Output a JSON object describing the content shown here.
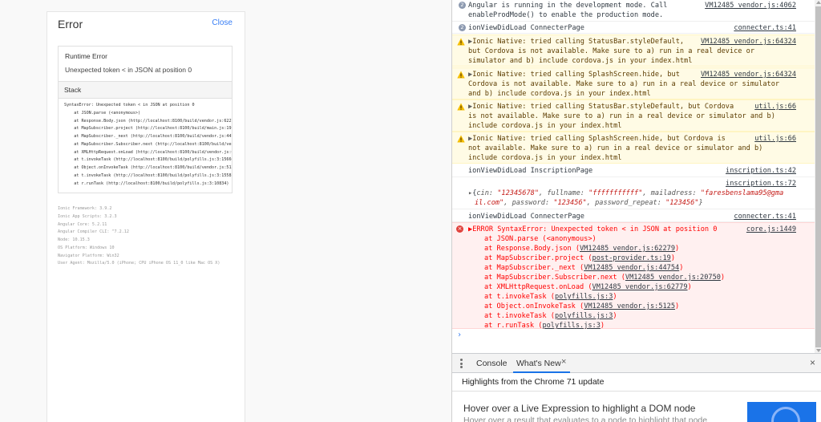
{
  "modal": {
    "title": "Error",
    "close_label": "Close",
    "runtime_title": "Runtime Error",
    "runtime_message": "Unexpected token < in JSON at position 0",
    "stack_title": "Stack",
    "stack_lines": [
      "SyntaxError: Unexpected token < in JSON at position 0",
      "    at JSON.parse (<anonymous>)",
      "    at Response.Body.json (http://localhost:8100/build/vendor.js:62279:25)",
      "    at MapSubscriber.project (http://localhost:8100/build/main.js:19:21)",
      "    at MapSubscriber._next (http://localhost:8100/build/vendor.js:44754:35)",
      "    at MapSubscriber.Subscriber.next (http://localhost:8100/build/vendor.js:20750:18)",
      "    at XMLHttpRequest.onLoad (http://localhost:8100/build/vendor.js:62779:51)",
      "    at t.invokeTask (http://localhost:8100/build/polyfills.js:3:15660)",
      "    at Object.onInvokeTask (http://localhost:8100/build/vendor.js:5125:33)",
      "    at t.invokeTask (http://localhost:8100/build/polyfills.js:3:15581)",
      "    at r.runTask (http://localhost:8100/build/polyfills.js:3:10834)"
    ],
    "env_lines": [
      "Ionic Framework: 3.9.2",
      "Ionic App Scripts: 3.2.3",
      "Angular Core: 5.2.11",
      "Angular Compiler CLI: ^7.2.12",
      "Node: 10.15.3",
      "OS Platform: Windows 10",
      "Navigator Platform: Win32",
      "User Agent: Mozilla/5.0 (iPhone; CPU iPhone OS 11_0 like Mac OS X)"
    ]
  },
  "console": {
    "messages": [
      {
        "kind": "info",
        "count": "2",
        "lines": [
          "Angular is running in the development mode. Call",
          "enableProdMode() to enable the production mode."
        ],
        "source": "VM12485 vendor.js:4062"
      },
      {
        "kind": "info",
        "count": "2",
        "lines": [
          "ionViewDidLoad ConnecterPage"
        ],
        "source": "connecter.ts:41"
      },
      {
        "kind": "warn",
        "lines": [
          "Ionic Native: tried calling StatusBar.styleDefault,",
          "but Cordova is not available. Make sure to a) run in a real device or",
          "simulator and b) include cordova.js in your index.html"
        ],
        "source": "VM12485 vendor.js:64324"
      },
      {
        "kind": "warn",
        "lines": [
          "Ionic Native: tried calling SplashScreen.hide, but",
          "Cordova is not available. Make sure to a) run in a real device or simulator",
          "and b) include cordova.js in your index.html"
        ],
        "source": "VM12485 vendor.js:64324"
      },
      {
        "kind": "warn",
        "lines": [
          "Ionic Native: tried calling StatusBar.styleDefault, but Cordova",
          "is not available. Make sure to a) run in a real device or simulator and b)",
          "include cordova.js in your index.html"
        ],
        "source": "util.js:66"
      },
      {
        "kind": "warn",
        "lines": [
          "Ionic Native: tried calling SplashScreen.hide, but Cordova is",
          "not available. Make sure to a) run in a real device or simulator and b)",
          "include cordova.js in your index.html"
        ],
        "source": "util.js:66"
      },
      {
        "kind": "log",
        "lines": [
          "ionViewDidLoad InscriptionPage"
        ],
        "source": "inscription.ts:42"
      },
      {
        "kind": "log",
        "lines": [],
        "source": "inscription.ts:72"
      },
      {
        "kind": "log",
        "lines": [
          "ionViewDidLoad ConnecterPage"
        ],
        "source": "connecter.ts:41"
      }
    ],
    "object_log": {
      "line1_keys": [
        "cin: ",
        "fullname: ",
        "mailadress: "
      ],
      "line1_vals": [
        "\"12345678\"",
        "\"fffffffffff\"",
        "\"faresbenslama95@gma"
      ],
      "line2_pre": "il.com\"",
      "line2_keys": [
        "password: ",
        "password_repeat: "
      ],
      "line2_vals": [
        "\"123456\"",
        "\"123456\""
      ]
    },
    "error": {
      "header": "ERROR SyntaxError: Unexpected token < in JSON at position 0",
      "source": "core.js:1449",
      "frames": [
        {
          "text": "at JSON.parse (<anonymous>)",
          "link": ""
        },
        {
          "text": "at Response.Body.json (",
          "link": "VM12485 vendor.js:62279"
        },
        {
          "text": "at MapSubscriber.project (",
          "link": "post-provider.ts:19"
        },
        {
          "text": "at MapSubscriber._next (",
          "link": "VM12485 vendor.js:44754"
        },
        {
          "text": "at MapSubscriber.Subscriber.next (",
          "link": "VM12485 vendor.js:20750"
        },
        {
          "text": "at XMLHttpRequest.onLoad (",
          "link": "VM12485 vendor.js:62779"
        },
        {
          "text": "at t.invokeTask (",
          "link": "polyfills.js:3"
        },
        {
          "text": "at Object.onInvokeTask (",
          "link": "VM12485 vendor.js:5125"
        },
        {
          "text": "at t.invokeTask (",
          "link": "polyfills.js:3"
        },
        {
          "text": "at r.runTask (",
          "link": "polyfills.js:3"
        }
      ]
    },
    "prompt": "›"
  },
  "drawer": {
    "tab_console": "Console",
    "tab_whatsnew": "What's New",
    "tab_close": "×",
    "drawer_close": "×",
    "highlights": "Highlights from the Chrome 71 update",
    "feature_title": "Hover over a Live Expression to highlight a DOM node",
    "feature_sub": "Hover over a result that evaluates to a node to highlight that node"
  },
  "icons": {
    "warning": "warning-triangle-icon",
    "error": "error-circle-icon",
    "menu": "three-dot-menu-icon"
  }
}
